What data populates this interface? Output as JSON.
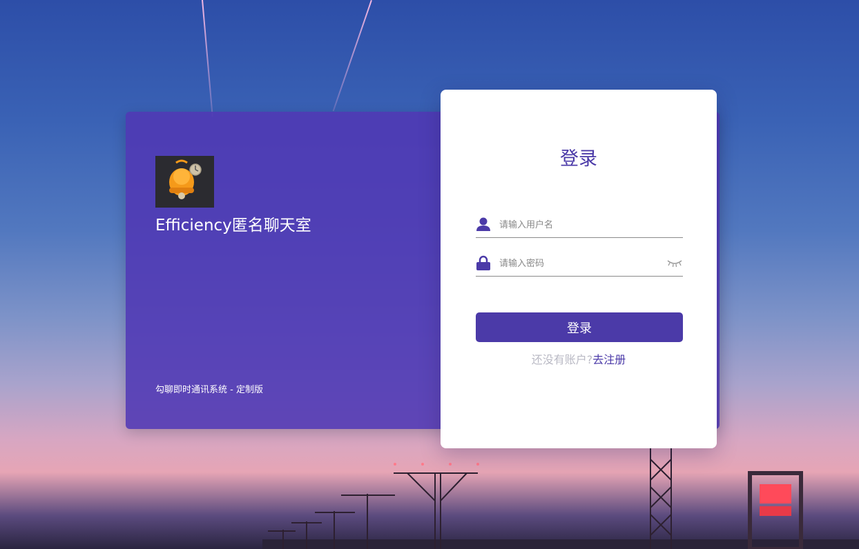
{
  "brand": {
    "app_name": "Efficiency匿名聊天室",
    "footer": "勾聊即时通讯系统 - 定制版",
    "logo_icon": "bell-icon"
  },
  "login": {
    "title": "登录",
    "username_placeholder": "请输入用户名",
    "password_placeholder": "请输入密码",
    "submit_label": "登录",
    "register_prompt": "还没有账户?",
    "register_link": "去注册"
  },
  "colors": {
    "accent": "#4b3aa8",
    "panel": "#5038b4",
    "muted_text": "#b9b9c4"
  }
}
